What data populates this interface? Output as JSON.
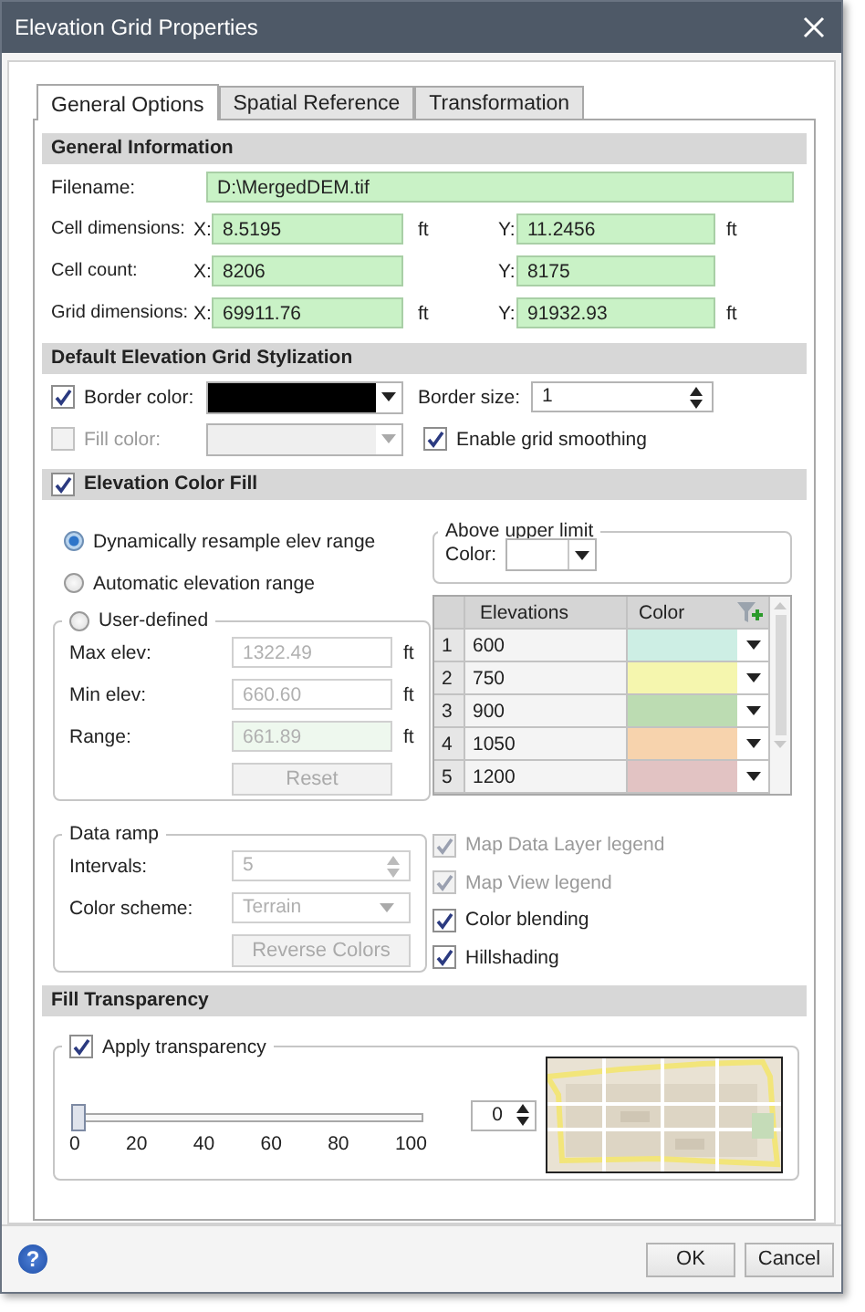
{
  "window": {
    "title": "Elevation Grid Properties"
  },
  "tabs": [
    {
      "label": "General Options",
      "selected": true
    },
    {
      "label": "Spatial Reference",
      "selected": false
    },
    {
      "label": "Transformation",
      "selected": false
    }
  ],
  "general_information": {
    "title": "General Information",
    "filename": {
      "label": "Filename:",
      "value": "D:\\MergedDEM.tif"
    },
    "rows": [
      {
        "label": "Cell dimensions:",
        "x_label": "X:",
        "x_value": "8.5195",
        "x_unit": "ft",
        "y_label": "Y:",
        "y_value": "11.2456",
        "y_unit": "ft"
      },
      {
        "label": "Cell count:",
        "x_label": "X:",
        "x_value": "8206",
        "y_label": "Y:",
        "y_value": "8175"
      },
      {
        "label": "Grid dimensions:",
        "x_label": "X:",
        "x_value": "69911.76",
        "x_unit": "ft",
        "y_label": "Y:",
        "y_value": "91932.93",
        "y_unit": "ft"
      }
    ]
  },
  "stylization": {
    "title": "Default Elevation Grid Stylization",
    "border_color": {
      "label": "Border color:",
      "checked": true,
      "disabled": false
    },
    "fill_color": {
      "label": "Fill color:",
      "checked": false,
      "disabled": true
    },
    "border_size": {
      "label": "Border size:",
      "value": "1"
    },
    "grid_smoothing": {
      "label": "Enable grid smoothing",
      "checked": true
    }
  },
  "elevation_color_fill": {
    "title": "Elevation Color Fill",
    "checked": true,
    "range_options": [
      {
        "label": "Dynamically resample elev range",
        "selected": true
      },
      {
        "label": "Automatic elevation range",
        "selected": false
      }
    ],
    "user_defined": {
      "label": "User-defined",
      "selected": false,
      "fields": [
        {
          "label": "Max elev:",
          "value": "1322.49",
          "unit": "ft",
          "kind": "input"
        },
        {
          "label": "Min elev:",
          "value": "660.60",
          "unit": "ft",
          "kind": "input"
        },
        {
          "label": "Range:",
          "value": "661.89",
          "unit": "ft",
          "kind": "readonly"
        }
      ],
      "reset": "Reset"
    },
    "above_upper_limit": {
      "title": "Above upper limit",
      "color_label": "Color:"
    },
    "table": {
      "columns": [
        "Elevations",
        "Color"
      ],
      "rows": [
        {
          "index": "1",
          "elevation": "600",
          "color": "#cdeee4"
        },
        {
          "index": "2",
          "elevation": "750",
          "color": "#f5f6ae"
        },
        {
          "index": "3",
          "elevation": "900",
          "color": "#bcdcb2"
        },
        {
          "index": "4",
          "elevation": "1050",
          "color": "#f7d3ad"
        },
        {
          "index": "5",
          "elevation": "1200",
          "color": "#e2c3c3"
        }
      ]
    },
    "data_ramp": {
      "title": "Data ramp",
      "intervals": {
        "label": "Intervals:",
        "value": "5"
      },
      "color_scheme": {
        "label": "Color scheme:",
        "value": "Terrain"
      },
      "reverse": "Reverse Colors"
    },
    "options": [
      {
        "label": "Map Data Layer legend",
        "checked": true,
        "disabled": true
      },
      {
        "label": "Map View legend",
        "checked": true,
        "disabled": true
      },
      {
        "label": "Color blending",
        "checked": true,
        "disabled": false
      },
      {
        "label": "Hillshading",
        "checked": true,
        "disabled": false
      }
    ]
  },
  "fill_transparency": {
    "title": "Fill Transparency",
    "apply": {
      "label": "Apply transparency",
      "checked": true
    },
    "slider": {
      "level": 0,
      "ticks": [
        "0",
        "20",
        "40",
        "60",
        "80",
        "100"
      ]
    },
    "value": "0"
  },
  "footer": {
    "help": "?",
    "buttons": [
      "OK",
      "Cancel"
    ]
  }
}
